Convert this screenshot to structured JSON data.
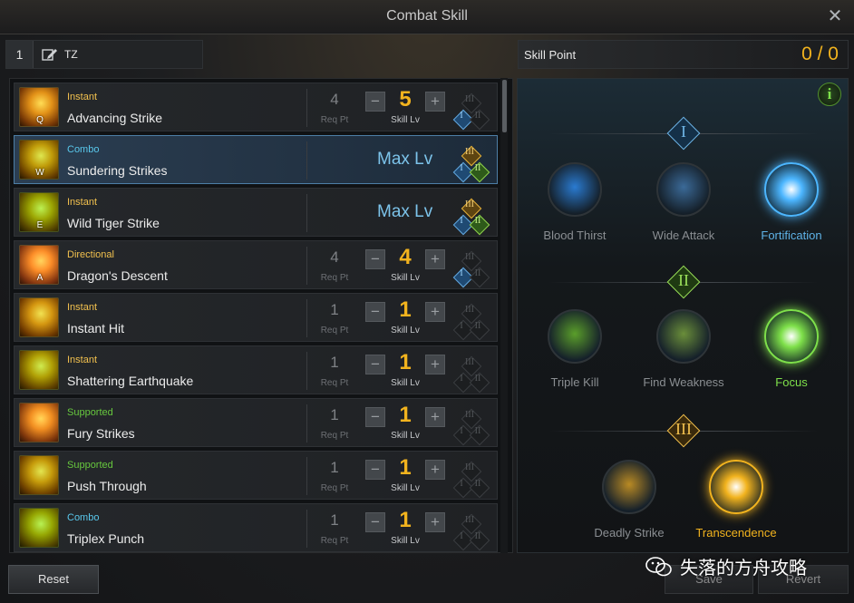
{
  "window": {
    "title": "Combat Skill"
  },
  "preset": {
    "number": "1",
    "name": "TZ"
  },
  "skill_point": {
    "label": "Skill Point",
    "value": "0 / 0"
  },
  "labels": {
    "req_pt": "Req Pt",
    "skill_lv": "Skill Lv",
    "max_lv": "Max Lv",
    "minus": "−",
    "plus": "+"
  },
  "tier_numerals": [
    "I",
    "II",
    "III"
  ],
  "skills": [
    {
      "key": "Q",
      "type": "Instant",
      "type_color": "#f2c14e",
      "name": "Advancing Strike",
      "req": "4",
      "level": "5",
      "max": false,
      "selected": false,
      "tripod": [
        1,
        0,
        0
      ]
    },
    {
      "key": "W",
      "type": "Combo",
      "type_color": "#59c8ec",
      "name": "Sundering Strikes",
      "req": "",
      "level": "",
      "max": true,
      "selected": true,
      "tripod": [
        1,
        1,
        1
      ]
    },
    {
      "key": "E",
      "type": "Instant",
      "type_color": "#f2c14e",
      "name": "Wild Tiger Strike",
      "req": "",
      "level": "",
      "max": true,
      "selected": false,
      "tripod": [
        1,
        1,
        1
      ]
    },
    {
      "key": "A",
      "type": "Directional",
      "type_color": "#f2c14e",
      "name": "Dragon's Descent",
      "req": "4",
      "level": "4",
      "max": false,
      "selected": false,
      "tripod": [
        1,
        0,
        0
      ]
    },
    {
      "key": "",
      "type": "Instant",
      "type_color": "#f2c14e",
      "name": "Instant Hit",
      "req": "1",
      "level": "1",
      "max": false,
      "selected": false,
      "tripod": [
        0,
        0,
        0
      ]
    },
    {
      "key": "",
      "type": "Instant",
      "type_color": "#f2c14e",
      "name": "Shattering Earthquake",
      "req": "1",
      "level": "1",
      "max": false,
      "selected": false,
      "tripod": [
        0,
        0,
        0
      ]
    },
    {
      "key": "",
      "type": "Supported",
      "type_color": "#67c83e",
      "name": "Fury Strikes",
      "req": "1",
      "level": "1",
      "max": false,
      "selected": false,
      "tripod": [
        0,
        0,
        0
      ]
    },
    {
      "key": "",
      "type": "Supported",
      "type_color": "#67c83e",
      "name": "Push Through",
      "req": "1",
      "level": "1",
      "max": false,
      "selected": false,
      "tripod": [
        0,
        0,
        0
      ]
    },
    {
      "key": "",
      "type": "Combo",
      "type_color": "#59c8ec",
      "name": "Triplex Punch",
      "req": "1",
      "level": "1",
      "max": false,
      "selected": false,
      "tripod": [
        0,
        0,
        0
      ]
    }
  ],
  "tripods": {
    "tier1": [
      {
        "name": "Blood Thirst",
        "active": false,
        "color": "#2a7bd1",
        "icon": "blood-thirst-icon"
      },
      {
        "name": "Wide Attack",
        "active": false,
        "color": "#3b6a98",
        "icon": "wide-attack-icon"
      },
      {
        "name": "Fortification",
        "active": true,
        "color": "#4cb6ff",
        "icon": "fortification-icon"
      }
    ],
    "tier2": [
      {
        "name": "Triple Kill",
        "active": false,
        "color": "#5a9e2a",
        "icon": "triple-kill-icon"
      },
      {
        "name": "Find Weakness",
        "active": false,
        "color": "#6a8e3a",
        "icon": "find-weakness-icon"
      },
      {
        "name": "Focus",
        "active": true,
        "color": "#7ee04a",
        "icon": "focus-icon"
      }
    ],
    "tier3": [
      {
        "name": "Deadly Strike",
        "active": false,
        "color": "#b98a24",
        "icon": "deadly-strike-icon"
      },
      {
        "name": "Transcendence",
        "active": true,
        "color": "#f2b31e",
        "icon": "transcendence-icon"
      }
    ]
  },
  "footer": {
    "reset": "Reset",
    "save": "Save",
    "revert": "Revert"
  },
  "watermark": "失落的方舟攻略",
  "colors": {
    "gold": "#f2b31e",
    "maxlv": "#7cc3ea",
    "active_tripod_text": "#5fb3e8",
    "active_tier2_text": "#7ee04a",
    "active_tier3_text": "#f2b31e",
    "inactive_tripod_text": "#8a8e92"
  }
}
